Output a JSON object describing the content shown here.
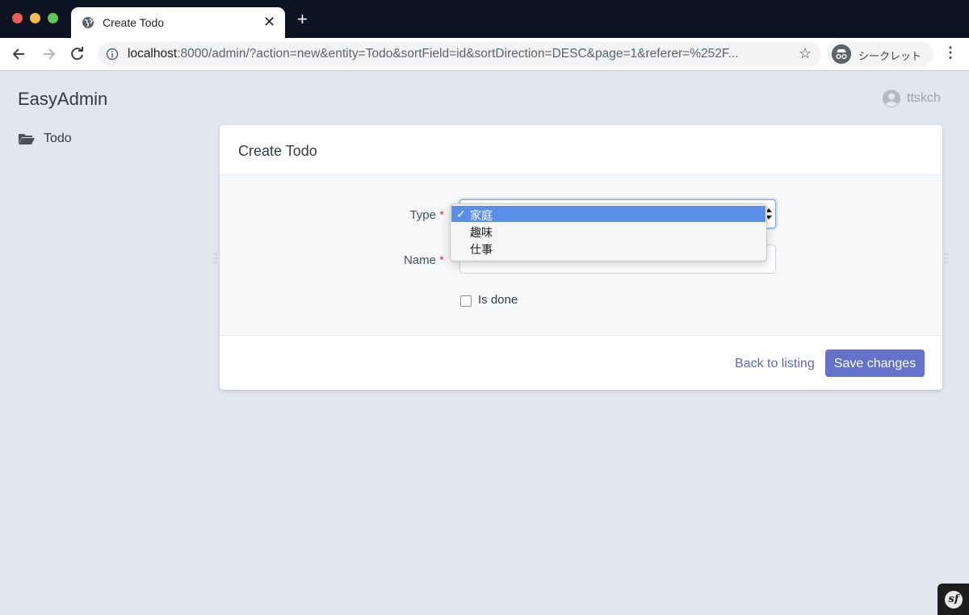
{
  "browser": {
    "tab_title": "Create Todo",
    "url_host": "localhost",
    "url_rest": ":8000/admin/?action=new&entity=Todo&sortField=id&sortDirection=DESC&page=1&referer=%252F...",
    "profile_label": "シークレット",
    "new_tab_symbol": "+",
    "close_symbol": "✕",
    "bookmark_symbol": "☆",
    "menu_symbol": "⋮"
  },
  "app": {
    "brand": "EasyAdmin",
    "user_name": "ttskch"
  },
  "sidebar": {
    "items": [
      {
        "label": "Todo",
        "icon": "folder-open-icon"
      }
    ]
  },
  "form": {
    "title": "Create Todo",
    "type_label": "Type",
    "name_label": "Name",
    "required_mark": "*",
    "is_done_label": "Is done",
    "is_done_checked": false,
    "name_value": "",
    "back_label": "Back to listing",
    "save_label": "Save changes"
  },
  "type_dropdown": {
    "open": true,
    "check_symbol": "✓",
    "options": [
      "家庭",
      "趣味",
      "仕事"
    ],
    "selected": "家庭"
  },
  "colors": {
    "accent": "#6473c9",
    "link": "#5a67c9",
    "selection": "#5a8ee7",
    "page_bg": "#e2e6ee"
  },
  "symfony_toolbar": {
    "label": "sf"
  }
}
